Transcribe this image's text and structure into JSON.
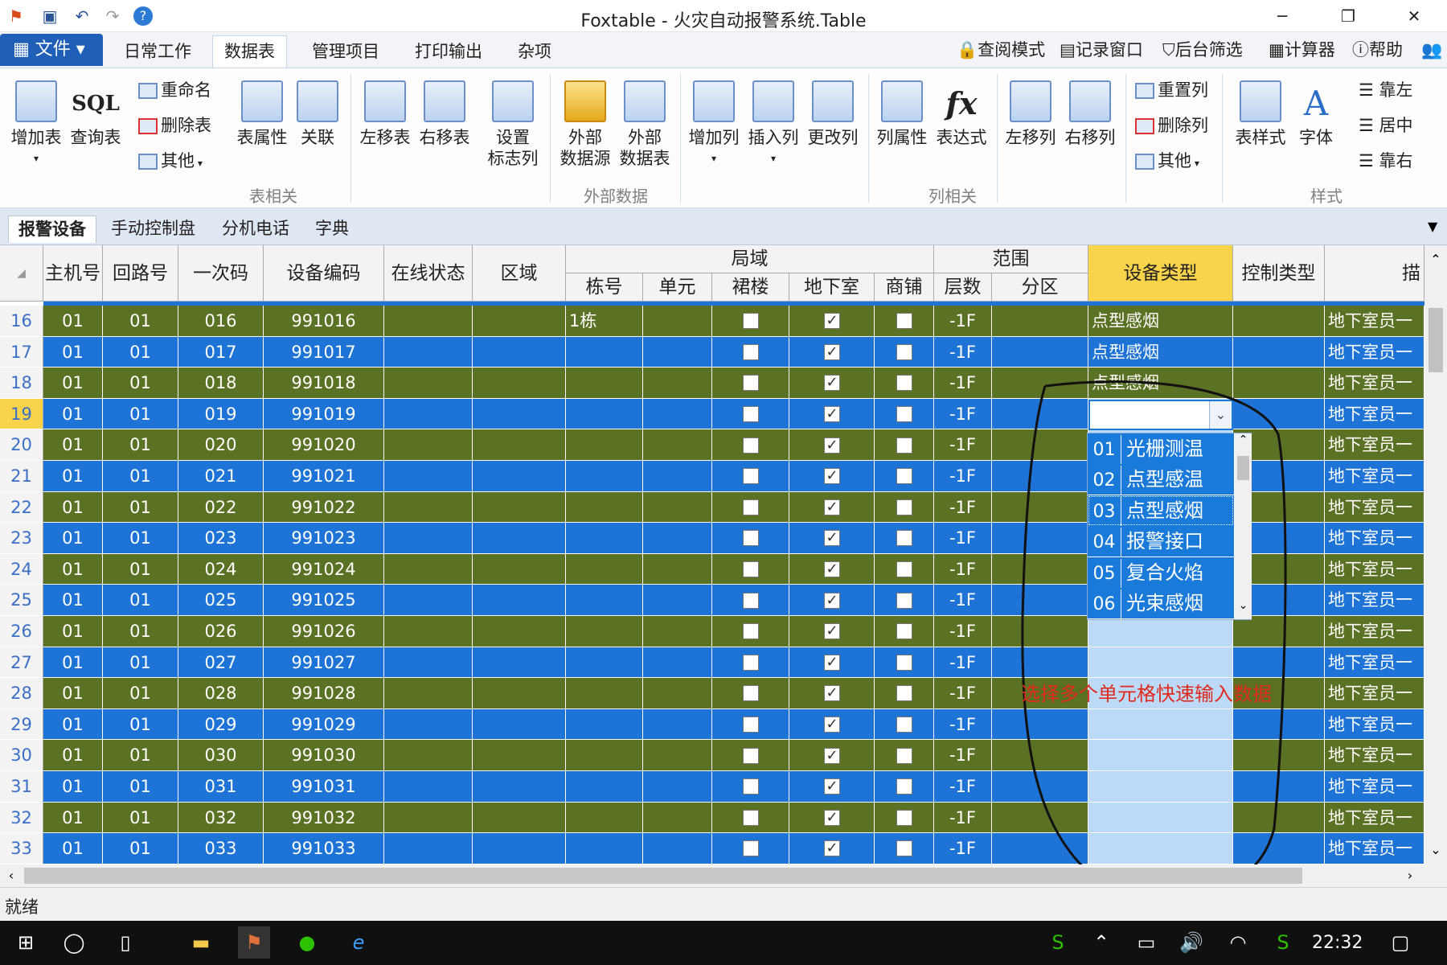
{
  "window": {
    "title": "Foxtable - 火灾自动报警系统.Table"
  },
  "menu": {
    "file_label": "文件",
    "tabs": [
      "日常工作",
      "数据表",
      "管理项目",
      "打印输出",
      "杂项"
    ],
    "right_tools": [
      "查阅模式",
      "记录窗口",
      "后台筛选",
      "计算器",
      "帮助"
    ]
  },
  "ribbon": {
    "buttons": {
      "add_table": "增加表",
      "query_table": "查询表",
      "rename": "重命名",
      "delete_table": "删除表",
      "other1": "其他",
      "table_props": "表属性",
      "relation": "关联",
      "move_left_table": "左移表",
      "move_right_table": "右移表",
      "set_flag_col_1": "设置",
      "set_flag_col_2": "标志列",
      "ext_source_1": "外部",
      "ext_source_2": "数据源",
      "ext_table_1": "外部",
      "ext_table_2": "数据表",
      "add_col": "增加列",
      "insert_col": "插入列",
      "change_col": "更改列",
      "col_props": "列属性",
      "expression": "表达式",
      "move_left_col": "左移列",
      "move_right_col": "右移列",
      "reset_col": "重置列",
      "delete_col": "删除列",
      "other2": "其他",
      "table_style": "表样式",
      "font": "字体",
      "align_left": "靠左",
      "align_center": "居中",
      "align_right": "靠右"
    },
    "groups": [
      "表相关",
      "外部数据",
      "列相关",
      "样式"
    ]
  },
  "sheet_tabs": [
    "报警设备",
    "手动控制盘",
    "分机电话",
    "字典"
  ],
  "grid": {
    "headers": {
      "host": "主机号",
      "loop": "回路号",
      "primary_code": "一次码",
      "device_code": "设备编码",
      "online": "在线状态",
      "area": "区域",
      "bureau": "局域",
      "building": "栋号",
      "unit": "单元",
      "podium": "裙楼",
      "basement": "地下室",
      "shop": "商铺",
      "scope": "范围",
      "floors": "层数",
      "zone": "分区",
      "device_type": "设备类型",
      "control_type": "控制类型",
      "desc": "描"
    },
    "rows": [
      {
        "n": "16",
        "host": "01",
        "loop": "01",
        "pc": "016",
        "dc": "991016",
        "building": "1栋",
        "podium": false,
        "basement": true,
        "shop": false,
        "floor": "-1F",
        "type": "点型感烟",
        "desc": "地下室员一"
      },
      {
        "n": "17",
        "host": "01",
        "loop": "01",
        "pc": "017",
        "dc": "991017",
        "building": "",
        "podium": false,
        "basement": true,
        "shop": false,
        "floor": "-1F",
        "type": "点型感烟",
        "desc": "地下室员一"
      },
      {
        "n": "18",
        "host": "01",
        "loop": "01",
        "pc": "018",
        "dc": "991018",
        "building": "",
        "podium": false,
        "basement": true,
        "shop": false,
        "floor": "-1F",
        "type": "点型感烟",
        "desc": "地下室员一"
      },
      {
        "n": "19",
        "host": "01",
        "loop": "01",
        "pc": "019",
        "dc": "991019",
        "building": "",
        "podium": false,
        "basement": true,
        "shop": false,
        "floor": "-1F",
        "type": "",
        "desc": "地下室员一"
      },
      {
        "n": "20",
        "host": "01",
        "loop": "01",
        "pc": "020",
        "dc": "991020",
        "building": "",
        "podium": false,
        "basement": true,
        "shop": false,
        "floor": "-1F",
        "type": "",
        "desc": "地下室员一"
      },
      {
        "n": "21",
        "host": "01",
        "loop": "01",
        "pc": "021",
        "dc": "991021",
        "building": "",
        "podium": false,
        "basement": true,
        "shop": false,
        "floor": "-1F",
        "type": "",
        "desc": "地下室员一"
      },
      {
        "n": "22",
        "host": "01",
        "loop": "01",
        "pc": "022",
        "dc": "991022",
        "building": "",
        "podium": false,
        "basement": true,
        "shop": false,
        "floor": "-1F",
        "type": "",
        "desc": "地下室员一"
      },
      {
        "n": "23",
        "host": "01",
        "loop": "01",
        "pc": "023",
        "dc": "991023",
        "building": "",
        "podium": false,
        "basement": true,
        "shop": false,
        "floor": "-1F",
        "type": "",
        "desc": "地下室员一"
      },
      {
        "n": "24",
        "host": "01",
        "loop": "01",
        "pc": "024",
        "dc": "991024",
        "building": "",
        "podium": false,
        "basement": true,
        "shop": false,
        "floor": "-1F",
        "type": "",
        "desc": "地下室员一"
      },
      {
        "n": "25",
        "host": "01",
        "loop": "01",
        "pc": "025",
        "dc": "991025",
        "building": "",
        "podium": false,
        "basement": true,
        "shop": false,
        "floor": "-1F",
        "type": "",
        "desc": "地下室员一"
      },
      {
        "n": "26",
        "host": "01",
        "loop": "01",
        "pc": "026",
        "dc": "991026",
        "building": "",
        "podium": false,
        "basement": true,
        "shop": false,
        "floor": "-1F",
        "type": "",
        "desc": "地下室员一"
      },
      {
        "n": "27",
        "host": "01",
        "loop": "01",
        "pc": "027",
        "dc": "991027",
        "building": "",
        "podium": false,
        "basement": true,
        "shop": false,
        "floor": "-1F",
        "type": "",
        "desc": "地下室员一"
      },
      {
        "n": "28",
        "host": "01",
        "loop": "01",
        "pc": "028",
        "dc": "991028",
        "building": "",
        "podium": false,
        "basement": true,
        "shop": false,
        "floor": "-1F",
        "type": "",
        "desc": "地下室员一"
      },
      {
        "n": "29",
        "host": "01",
        "loop": "01",
        "pc": "029",
        "dc": "991029",
        "building": "",
        "podium": false,
        "basement": true,
        "shop": false,
        "floor": "-1F",
        "type": "",
        "desc": "地下室员一"
      },
      {
        "n": "30",
        "host": "01",
        "loop": "01",
        "pc": "030",
        "dc": "991030",
        "building": "",
        "podium": false,
        "basement": true,
        "shop": false,
        "floor": "-1F",
        "type": "",
        "desc": "地下室员一"
      },
      {
        "n": "31",
        "host": "01",
        "loop": "01",
        "pc": "031",
        "dc": "991031",
        "building": "",
        "podium": false,
        "basement": true,
        "shop": false,
        "floor": "-1F",
        "type": "",
        "desc": "地下室员一"
      },
      {
        "n": "32",
        "host": "01",
        "loop": "01",
        "pc": "032",
        "dc": "991032",
        "building": "",
        "podium": false,
        "basement": true,
        "shop": false,
        "floor": "-1F",
        "type": "",
        "desc": "地下室员一"
      },
      {
        "n": "33",
        "host": "01",
        "loop": "01",
        "pc": "033",
        "dc": "991033",
        "building": "",
        "podium": false,
        "basement": true,
        "shop": false,
        "floor": "-1F",
        "type": "",
        "desc": "地下室员一"
      }
    ],
    "current_row": "19"
  },
  "dropdown": {
    "items": [
      {
        "code": "01",
        "name": "光栅测温"
      },
      {
        "code": "02",
        "name": "点型感温"
      },
      {
        "code": "03",
        "name": "点型感烟"
      },
      {
        "code": "04",
        "name": "报警接口"
      },
      {
        "code": "05",
        "name": "复合火焰"
      },
      {
        "code": "06",
        "name": "光束感烟"
      }
    ],
    "highlighted": "03"
  },
  "annotation": {
    "text": "选择多个单元格快速输入数据"
  },
  "status": {
    "text": "就绪"
  },
  "taskbar": {
    "time": "22:32"
  },
  "colors": {
    "row_even": "#5b7224",
    "row_odd": "#1e73d6",
    "selected_col": "#bcd9f8",
    "header_selected": "#f9d34a",
    "annotation": "#e0291b"
  }
}
